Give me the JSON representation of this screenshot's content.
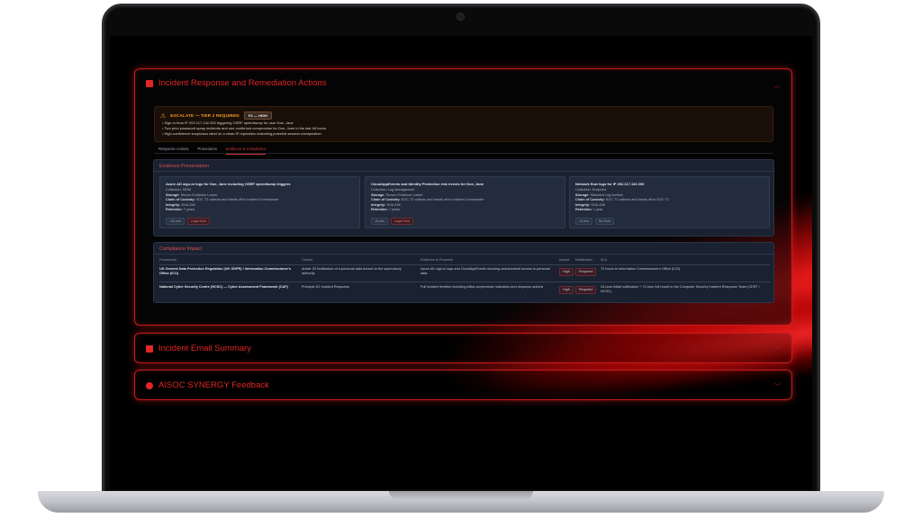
{
  "main_panel": {
    "title": "Incident Response and Remediation Actions",
    "escalate": {
      "label": "ESCALATE — TIER 2 REQUIRED",
      "badge": "P2 — HIGH",
      "bullets": [
        "Sign-in from IP 202.117.132.200 triggering OSRF speedbump for user Doe, Jane",
        "Two prior password spray incidents and one confirmed compromise for Doe, Jane in the last 48 hours",
        "High-confidence suspicious label on a clean IP reputation indicating potential session manipulation"
      ]
    },
    "tabs": [
      {
        "label": "Response Actions",
        "active": false
      },
      {
        "label": "Procedures",
        "active": false
      },
      {
        "label": "Evidence & Compliance",
        "active": true
      }
    ],
    "evidence": {
      "title": "Evidence Preservation",
      "cards": [
        {
          "title": "Azure AD sign-in logs for Doe, Jane including OSRF speedbump triggers",
          "collection": "Collection: SIEM",
          "storage_label": "Storage:",
          "storage": "Secure Evidence Locker",
          "custody_label": "Chain of Custody:",
          "custody": "SOC T2 collects and hands off to Incident Commander",
          "integrity_label": "Integrity:",
          "integrity": "SHA-256",
          "retention_label": "Retention:",
          "retention": "7 years",
          "time_tag": "<30 min",
          "hold_tag": "Legal Hold"
        },
        {
          "title": "CloudAppEvents and Identity Protection risk events for Doe, Jane",
          "collection": "Collection: Log Management",
          "storage_label": "Storage:",
          "storage": "Secure Evidence Locker",
          "custody_label": "Chain of Custody:",
          "custody": "SOC T2 collects and hands off to Incident Commander",
          "integrity_label": "Integrity:",
          "integrity": "SHA-256",
          "retention_label": "Retention:",
          "retention": "7 years",
          "time_tag": "<6 min",
          "hold_tag": "Legal Hold"
        },
        {
          "title": "Network flow logs for IP 202.117.132.200",
          "collection": "Collection: Endpoint",
          "storage_label": "Storage:",
          "storage": "Standard Log Archive",
          "custody_label": "Chain of Custody:",
          "custody": "SOC T1 collects and hands off to SOC T2",
          "integrity_label": "Integrity:",
          "integrity": "SHA-256",
          "retention_label": "Retention:",
          "retention": "1 year",
          "time_tag": "<5 min",
          "hold_tag": "No Hold"
        }
      ]
    },
    "compliance": {
      "title": "Compliance Impact",
      "headers": {
        "framework": "Framework",
        "control": "Control",
        "evidence": "Evidence to Preserve",
        "impact": "Impact",
        "notification": "Notification",
        "sla": "SLA"
      },
      "rows": [
        {
          "framework": "UK General Data Protection Regulation (UK GDPR) / Information Commissioner's Office (ICO)",
          "control": "Article 33 Notification of a personal data breach to the supervisory authority",
          "evidence": "Azure AD sign-in logs and CloudAppEvents showing unauthorised access to personal data",
          "impact": "High",
          "notification": "Required",
          "sla": "72 hours to Information Commissioner's Office (ICO)"
        },
        {
          "framework": "National Cyber Security Centre (NCSC) — Cyber Assessment Framework (CAF)",
          "control": "Principle D1 Incident Response",
          "evidence": "Full incident timeline including initial compromise indicators and response actions",
          "impact": "High",
          "notification": "Required",
          "sla": "24-hour initial notification + 72-hour full report to the Computer Security Incident Response Team (CERT / NCSC)"
        }
      ]
    }
  },
  "email_panel": {
    "title": "Incident Email Summary"
  },
  "feedback_panel": {
    "title": "AISOC SYNERGY Feedback"
  },
  "icons": {
    "main": "clipboard-icon",
    "email": "envelope-icon",
    "feedback": "chat-bubble-icon",
    "warning": "warning-triangle-icon",
    "expand": "chevron-icon"
  },
  "colors": {
    "accent": "#e02626",
    "warning": "#f2a024",
    "card_bg": "#1a2231"
  }
}
